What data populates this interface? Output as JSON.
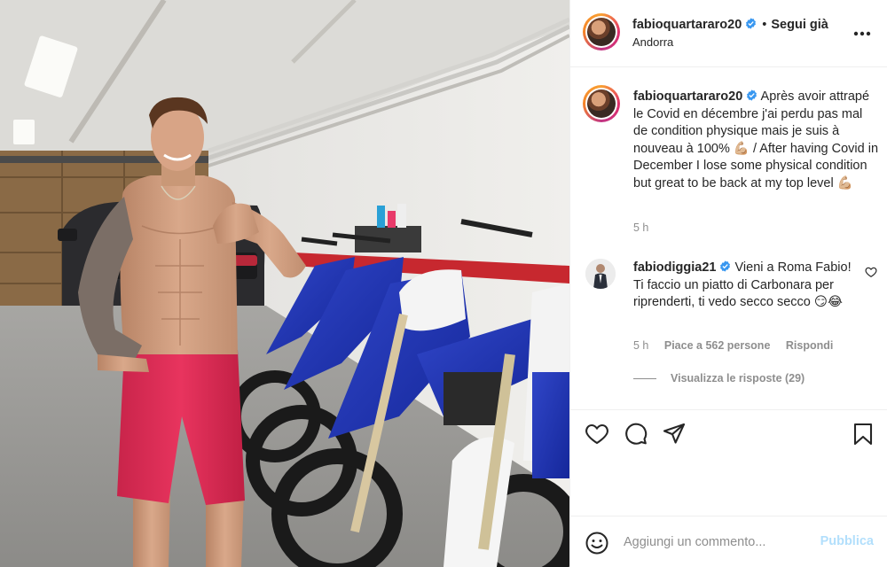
{
  "post": {
    "username": "fabioquartararo20",
    "follow_status": "Segui già",
    "location": "Andorra",
    "more_icon": "more-horizontal-icon",
    "verified_color": "#3897f0"
  },
  "caption": {
    "username": "fabioquartararo20",
    "text": "Après avoir attrapé le Covid en décembre j'ai perdu pas mal de condition physique mais je suis à nouveau à 100% 💪🏼 / After having Covid in December I lose some physical condition but great to be back at my top level 💪🏼",
    "time": "5 h"
  },
  "comment": {
    "username": "fabiodiggia21",
    "text": "Vieni a Roma Fabio! Ti faccio un piatto di Carbonara per riprenderti, ti vedo secco secco 😏😂",
    "time": "5 h",
    "likes": "Piace a 562 persone",
    "reply": "Rispondi",
    "view_replies": "Visualizza le risposte (29)"
  },
  "actions": {
    "icons": [
      "heart-icon",
      "comment-icon",
      "share-icon",
      "bookmark-icon"
    ]
  },
  "add_comment": {
    "placeholder": "Aggiungi un commento...",
    "publish": "Pubblica",
    "publish_color": "#b2dffc"
  }
}
